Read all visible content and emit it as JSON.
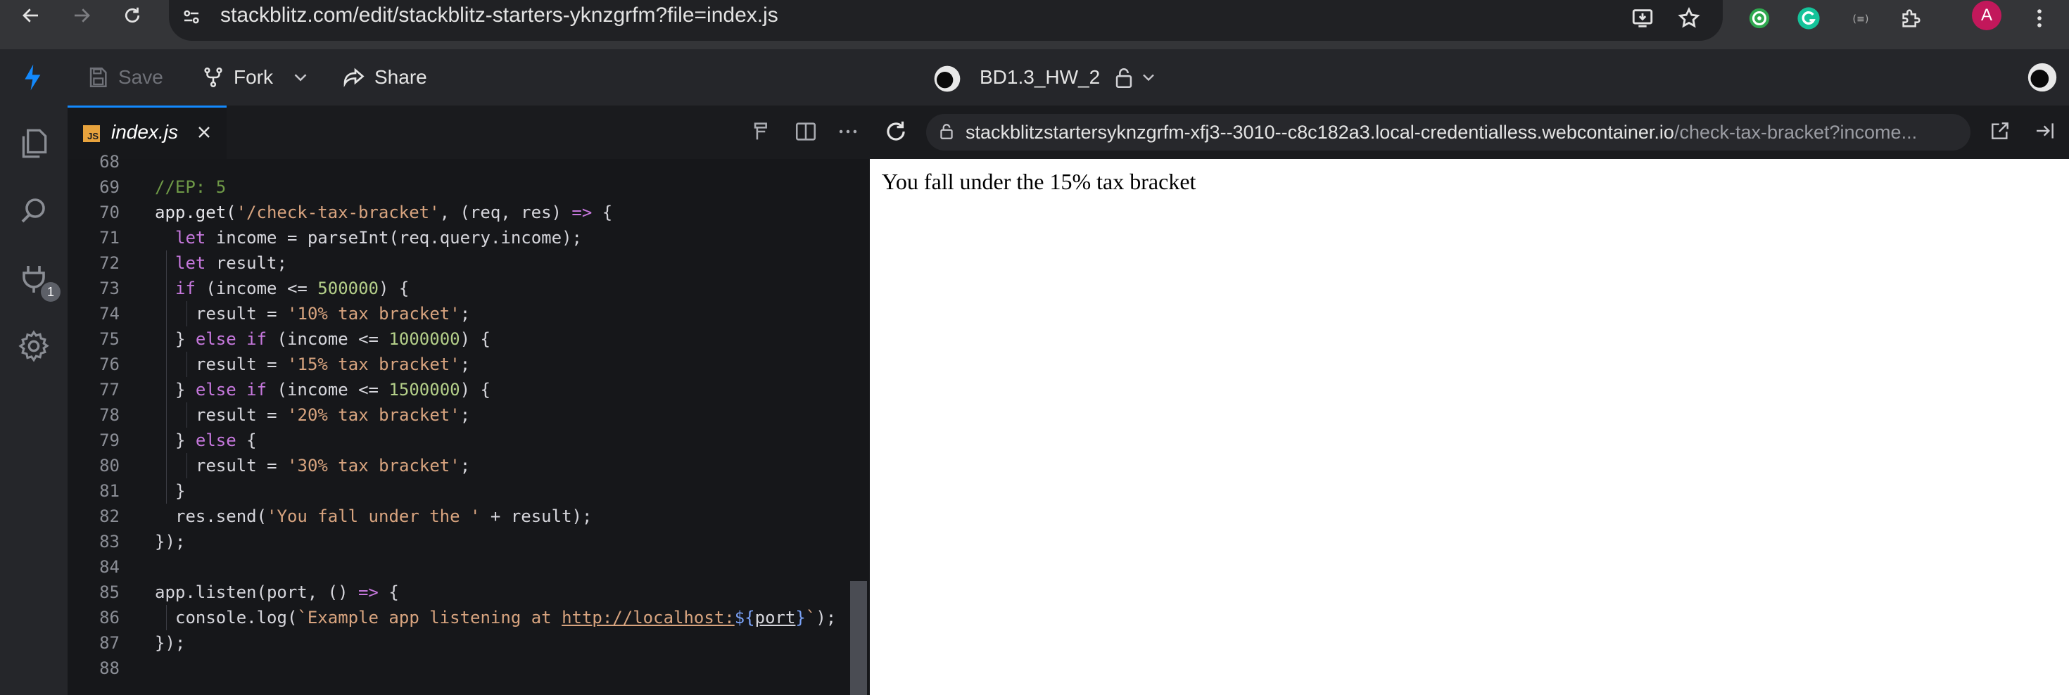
{
  "browser": {
    "url_domain": "stackblitz.com",
    "url_path": "/edit/stackblitz-starters-yknzgrfm?file=index.js",
    "profile_initial": "A",
    "icons": [
      "back-icon",
      "forward-icon",
      "reload-icon",
      "site-info-icon",
      "install-app-icon",
      "bookmark-star-icon",
      "extension-circle-icon",
      "grammarly-icon",
      "extension-pill-icon",
      "extensions-puzzle-icon",
      "more-vert-icon"
    ]
  },
  "header": {
    "save_label": "Save",
    "fork_label": "Fork",
    "share_label": "Share",
    "project_name": "BD1.3_HW_2"
  },
  "activity": {
    "extensions_badge": "1"
  },
  "editor": {
    "tab_badge": "JS",
    "tab_name": "index.js",
    "partial_line_number": "68",
    "line_numbers": [
      "69",
      "70",
      "71",
      "72",
      "73",
      "74",
      "75",
      "76",
      "77",
      "78",
      "79",
      "80",
      "81",
      "82",
      "83",
      "84",
      "85",
      "86",
      "87",
      "88"
    ],
    "tokens": {
      "l69": "//EP: 5",
      "l70_a": "app.get(",
      "l70_b": "'/check-tax-bracket'",
      "l70_c": ", (req, res) ",
      "l70_d": "=>",
      "l70_e": " {",
      "l71_a": "let",
      "l71_b": " income = parseInt(req.query.income);",
      "l72_a": "let",
      "l72_b": " result;",
      "l73_a": "if",
      "l73_b": " (income <= ",
      "l73_c": "500000",
      "l73_d": ") {",
      "l74_a": "result = ",
      "l74_b": "'10% tax bracket'",
      "l74_c": ";",
      "l75_a": "} ",
      "l75_b": "else if",
      "l75_c": " (income <= ",
      "l75_d": "1000000",
      "l75_e": ") {",
      "l76_a": "result = ",
      "l76_b": "'15% tax bracket'",
      "l76_c": ";",
      "l77_a": "} ",
      "l77_b": "else if",
      "l77_c": " (income <= ",
      "l77_d": "1500000",
      "l77_e": ") {",
      "l78_a": "result = ",
      "l78_b": "'20% tax bracket'",
      "l78_c": ";",
      "l79_a": "} ",
      "l79_b": "else",
      "l79_c": " {",
      "l80_a": "result = ",
      "l80_b": "'30% tax bracket'",
      "l80_c": ";",
      "l81": "}",
      "l82_a": "res.send(",
      "l82_b": "'You fall under the '",
      "l82_c": " + result);",
      "l83": "});",
      "l85_a": "app.listen(port, () ",
      "l85_b": "=>",
      "l85_c": " {",
      "l86_a": "console.log(",
      "l86_b": "`Example app listening at ",
      "l86_c": "http://localhost:",
      "l86_d": "${",
      "l86_e": "port",
      "l86_f": "}",
      "l86_g": "`",
      "l86_h": ");",
      "l87": "});"
    }
  },
  "preview": {
    "url_host": "stackblitzstartersyknzgrfm-xfj3--3010--c8c182a3.local-credentialless.webcontainer.io",
    "url_path": "/check-tax-bracket?income...",
    "body_text": "You fall under the 15% tax bracket"
  },
  "colors": {
    "accent": "#1389fd",
    "editor_bg": "#16171a",
    "header_bg": "#25262a",
    "string": "#d8a47f",
    "keyword": "#c678dd",
    "number": "#b5d08a",
    "comment": "#6f9a47"
  }
}
